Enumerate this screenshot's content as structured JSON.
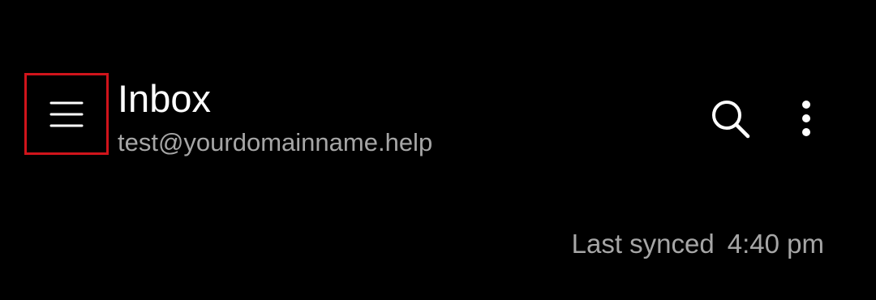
{
  "header": {
    "title": "Inbox",
    "account_email": "test@yourdomainname.help",
    "menu_icon": "hamburger-menu-icon",
    "search_icon": "search-icon",
    "more_icon": "more-vertical-icon",
    "highlight_color": "#d0141b"
  },
  "sync": {
    "label": "Last synced",
    "time": "4:40 pm"
  }
}
